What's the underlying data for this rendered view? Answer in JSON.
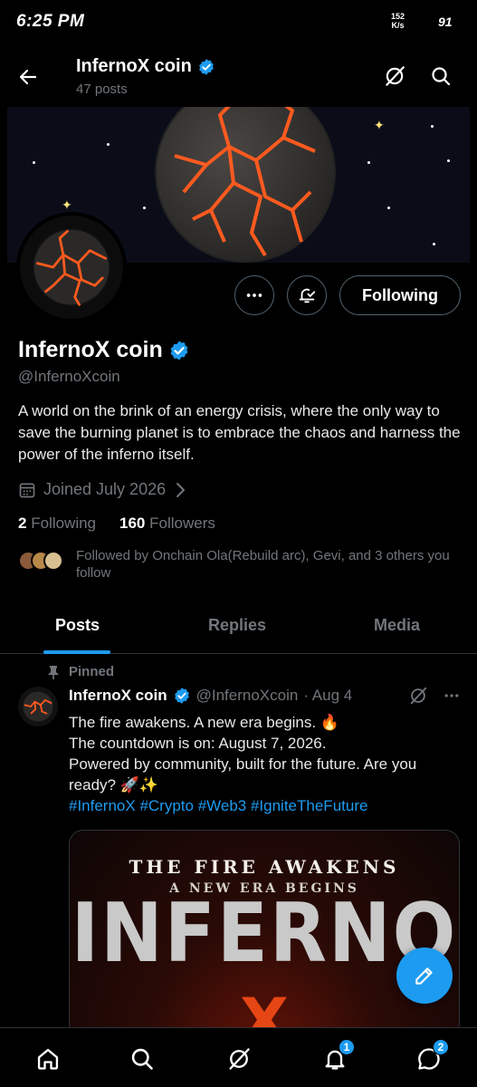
{
  "status_bar": {
    "time": "6:25 PM",
    "speed_value": "152",
    "speed_unit": "K/s",
    "battery": "91"
  },
  "header": {
    "title": "InfernoX coin",
    "posts_count": "47 posts"
  },
  "profile": {
    "display_name": "InfernoX coin",
    "handle": "@InfernoXcoin",
    "bio": "A world on the brink of an energy crisis, where the only way to save the burning planet is to embrace the chaos and harness the power of the inferno itself.",
    "joined": "Joined July 2026",
    "following_count": "2",
    "following_label": "Following",
    "followers_count": "160",
    "followers_label": "Followers",
    "followed_by": "Followed by Onchain Ola(Rebuild arc), Gevi, and 3 others you follow",
    "following_button": "Following"
  },
  "tabs": [
    "Posts",
    "Replies",
    "Media"
  ],
  "pinned_post": {
    "pinned_label": "Pinned",
    "author": "InfernoX coin",
    "handle": "@InfernoXcoin",
    "date": "· Aug 4",
    "lines": [
      "The fire awakens. A new era begins. 🔥",
      "The countdown is on: August 7, 2026.",
      "Powered by community, built for the future. Are you ready? 🚀✨"
    ],
    "hashtags": "#InfernoX #Crypto #Web3 #IgniteTheFuture",
    "media": {
      "line1": "THE FIRE AWAKENS",
      "line2": "A NEW ERA BEGINS",
      "line3": "INFERNO",
      "line4": "X"
    }
  },
  "bottom_nav": {
    "notifications_badge": "1",
    "messages_badge": "2"
  },
  "colors": {
    "accent": "#1d9bf0",
    "background": "#000000",
    "muted": "#71767b",
    "lava": "#ff5a1f"
  }
}
